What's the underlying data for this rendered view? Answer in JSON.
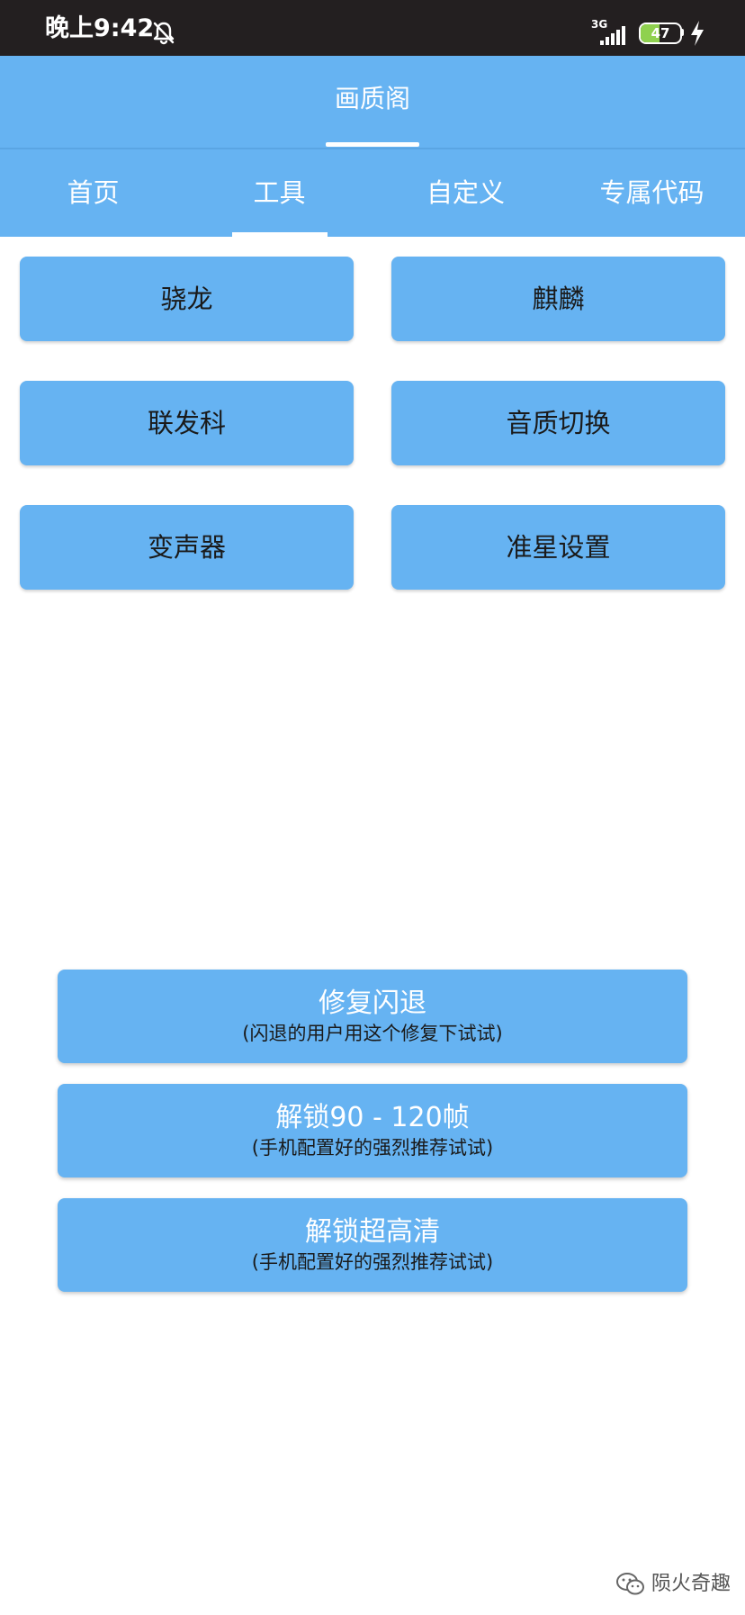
{
  "status_bar": {
    "time": "晚上9:42",
    "network": "3G",
    "battery_level": "47",
    "battery_fraction": 0.47
  },
  "header": {
    "title": "画质阁"
  },
  "tabs": [
    {
      "label": "首页"
    },
    {
      "label": "工具"
    },
    {
      "label": "自定义"
    },
    {
      "label": "专属代码"
    }
  ],
  "grid_buttons": [
    {
      "label": "骁龙"
    },
    {
      "label": "麒麟"
    },
    {
      "label": "联发科"
    },
    {
      "label": "音质切换"
    },
    {
      "label": "变声器"
    },
    {
      "label": "准星设置"
    }
  ],
  "actions": [
    {
      "title": "修复闪退",
      "subtitle": "(闪退的用户用这个修复下试试)"
    },
    {
      "title": "解锁90 - 120帧",
      "subtitle": "(手机配置好的强烈推荐试试)"
    },
    {
      "title": "解锁超高清",
      "subtitle": "(手机配置好的强烈推荐试试)"
    }
  ],
  "watermark": {
    "text": "陨火奇趣"
  },
  "colors": {
    "primary": "#66b3f2",
    "status_bar": "#231f20",
    "battery_fill": "#8fd14f"
  },
  "icons": {
    "bell": "bell-off-icon",
    "signal": "signal-icon",
    "charging": "charging-icon",
    "wechat": "wechat-icon"
  }
}
